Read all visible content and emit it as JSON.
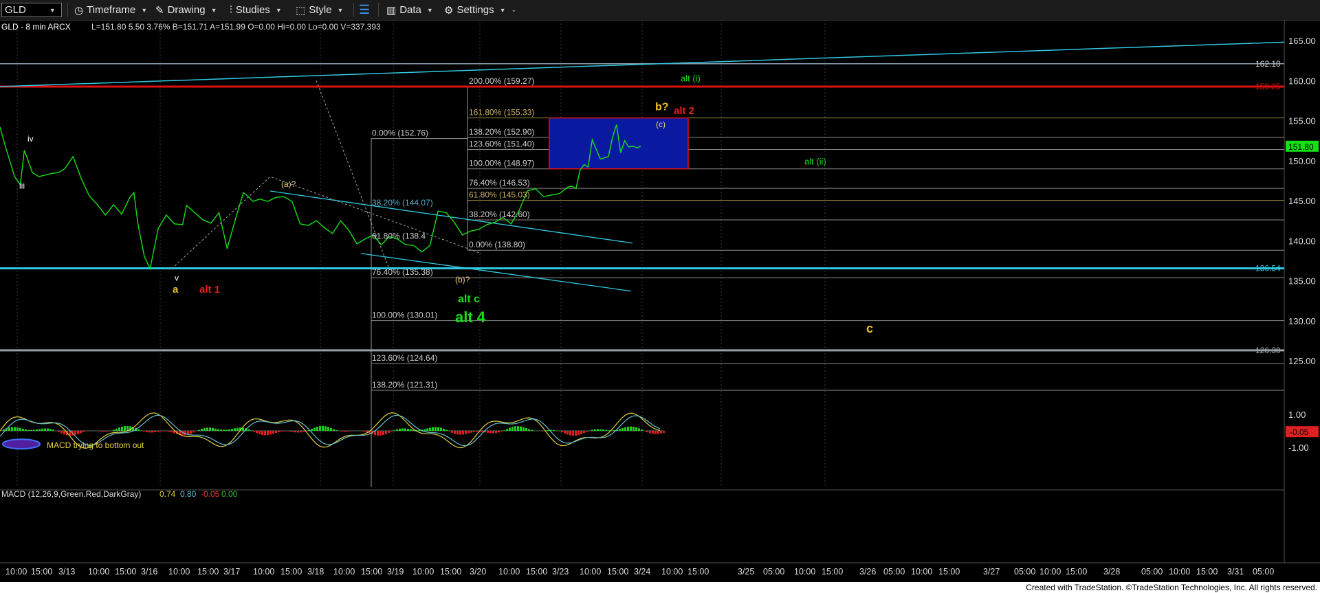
{
  "toolbar": {
    "symbol": "GLD",
    "items": [
      "Timeframe",
      "Drawing",
      "Studies",
      "Style",
      "Data",
      "Settings"
    ]
  },
  "colors": {
    "background": "#000000",
    "price_line": "#16e016",
    "red_level": "#e01010",
    "cyan_level": "#30c8e0",
    "target_box": "#0a1aa0",
    "fib_text": "#cccccc"
  },
  "chart_data": [
    {
      "type": "line",
      "title": "GLD - 8 min ARCX",
      "quote": "L=151.80  5.50  3.76%  B=151.71  A=151.99  O=0.00  Hi=0.00  Lo=0.00  V=337,393",
      "last_price": "151.80",
      "ylim": [
        120,
        167
      ],
      "y_ticks": [
        "165.00",
        "160.00",
        "155.00",
        "150.00",
        "145.00",
        "140.00",
        "135.00",
        "130.00",
        "125.00"
      ],
      "x_ticks": [
        "10:00",
        "15:00",
        "3/13",
        "10:00",
        "15:00",
        "3/16",
        "10:00",
        "15:00",
        "3/17",
        "10:00",
        "15:00",
        "3/18",
        "10:00",
        "15:00",
        "3/19",
        "10:00",
        "15:00",
        "3/20",
        "10:00",
        "15:00",
        "3/23",
        "10:00",
        "15:00",
        "3/24",
        "10:00",
        "15:00",
        "3/25",
        "05:00",
        "10:00",
        "15:00",
        "3/26",
        "05:00",
        "10:00",
        "15:00",
        "3/27",
        "05:00",
        "10:00",
        "15:00",
        "3/28",
        "05:00",
        "10:00",
        "15:00",
        "3/31",
        "05:00"
      ],
      "series": [
        {
          "x": [
            0,
            6,
            12,
            18,
            25,
            30,
            40,
            48,
            56,
            64,
            72,
            80,
            90,
            100,
            110,
            120,
            130,
            140,
            150,
            160,
            165,
            170,
            178,
            185,
            195,
            205,
            215,
            225,
            230,
            240,
            250,
            260,
            270,
            280,
            290,
            300,
            305,
            312,
            320,
            330,
            340,
            350,
            360,
            370,
            380,
            390,
            400,
            410,
            420,
            430,
            440,
            450,
            460,
            470,
            480,
            490,
            500,
            510,
            520,
            530,
            540,
            550,
            560,
            570,
            580,
            590,
            600,
            610,
            620,
            630,
            640,
            650,
            660,
            670,
            680,
            690,
            700,
            705,
            710,
            715,
            720,
            725,
            730,
            740,
            750,
            755,
            760,
            765,
            770,
            775,
            780,
            785,
            790
          ],
          "y": [
            154.2,
            152,
            150,
            148,
            147,
            151.3,
            148.5,
            148,
            148.2,
            148.4,
            148.5,
            149,
            150.5,
            147.8,
            145.6,
            144.5,
            143.2,
            144.5,
            143.3,
            145.4,
            146,
            142.1,
            138,
            136.5,
            141.5,
            143.2,
            142.1,
            142,
            144.4,
            143.5,
            142.6,
            142.2,
            143.5,
            139,
            142.6,
            146,
            145.6,
            144.9,
            145.2,
            144.9,
            145.4,
            145.5,
            144.9,
            142.1,
            141.9,
            142.5,
            141.6,
            140.9,
            142.5,
            141.3,
            139.6,
            140.2,
            140.7,
            139.5,
            140.5,
            140.2,
            139.5,
            139.4,
            138.6,
            139.4,
            143.7,
            143.5,
            142.3,
            140.7,
            141.2,
            141.4,
            142,
            142.3,
            142.9,
            142.1,
            143.8,
            146.2,
            146.5,
            145.5,
            145.7,
            145.9,
            146.7,
            146.8,
            146.5,
            148.8,
            149.5,
            149.2,
            152.6,
            150.2,
            150.5,
            152.9,
            154.5,
            151,
            152.5,
            151.7,
            151.8,
            151.6,
            151.8
          ]
        }
      ],
      "levels": [
        {
          "label": "162.10",
          "value": 162.1
        },
        {
          "label": "159.25",
          "value": 159.25
        },
        {
          "label": "136.54",
          "value": 136.54
        },
        {
          "label": "126.30",
          "value": 126.3
        }
      ],
      "fib_labels": [
        {
          "text": "200.00% (159.27)",
          "value": 159.27
        },
        {
          "text": "161.80% (155.33)",
          "value": 155.33
        },
        {
          "text": "138.20% (152.90)",
          "value": 152.9
        },
        {
          "text": "123.60% (151.40)",
          "value": 151.4
        },
        {
          "text": "100.00% (148.97)",
          "value": 148.97
        },
        {
          "text": "76.40% (146.53)",
          "value": 146.53
        },
        {
          "text": "61.80% (145.03)",
          "value": 145.03
        },
        {
          "text": "38.20% (142.60)",
          "value": 142.6
        },
        {
          "text": "0.00% (138.80)",
          "value": 138.8
        },
        {
          "text": "0.00% (152.76)",
          "value": 152.76
        },
        {
          "text": "38.20% (144.07)",
          "value": 144.07
        },
        {
          "text": "61.80% (138.4",
          "value": 139.9
        },
        {
          "text": "76.40% (135.38)",
          "value": 135.38
        },
        {
          "text": "100.00% (130.01)",
          "value": 130.01
        },
        {
          "text": "123.60% (124.64)",
          "value": 124.64
        },
        {
          "text": "138.20% (121.31)",
          "value": 121.31
        }
      ],
      "wave_labels": [
        "iv",
        "iii",
        "v",
        "a",
        "alt 1",
        "(a)?",
        "(b)?",
        "alt c",
        "alt 4",
        "b?",
        "alt 2",
        "(c)",
        "alt (i)",
        "alt (ii)",
        "c"
      ]
    },
    {
      "type": "line",
      "title": "MACD (12,26,9,Green,Red,DarkGray)",
      "values_text": [
        "0.74",
        "0.80",
        "-0.05",
        "0.00"
      ],
      "last_value": "-0.05",
      "annotation": "MACD trying to bottom out",
      "ylim": [
        -1.6,
        1.6
      ],
      "y_ticks": [
        "1.00",
        "0.00",
        "-1.00"
      ]
    }
  ],
  "footer": "Created with TradeStation. ©TradeStation Technologies, Inc. All rights reserved."
}
